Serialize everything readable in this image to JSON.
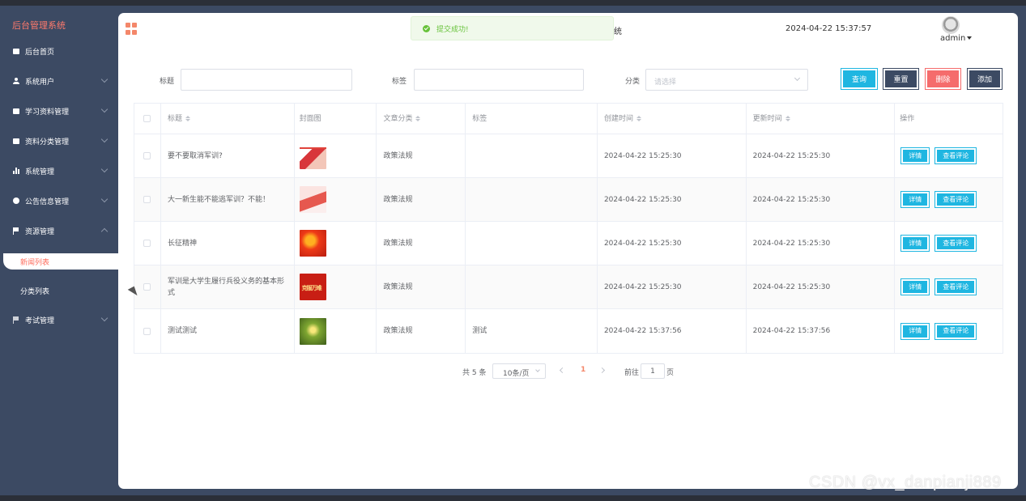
{
  "sidebar": {
    "brand": "后台管理系统",
    "items": [
      {
        "label": "后台首页",
        "icon": "monitor-icon"
      },
      {
        "label": "系统用户",
        "icon": "user-icon"
      },
      {
        "label": "学习资料管理",
        "icon": "doc-icon"
      },
      {
        "label": "资料分类管理",
        "icon": "doc-icon"
      },
      {
        "label": "系统管理",
        "icon": "bar-chart-icon"
      },
      {
        "label": "公告信息管理",
        "icon": "info-icon"
      },
      {
        "label": "资源管理",
        "icon": "flag-icon"
      },
      {
        "label": "考试管理",
        "icon": "flag-icon"
      }
    ],
    "subitems": [
      {
        "label": "新闻列表",
        "active": true
      },
      {
        "label": "分类列表",
        "active": false
      }
    ]
  },
  "header": {
    "toast": "提交成功!",
    "title_fragment": "统",
    "datetime": "2024-04-22 15:37:57",
    "user": "admin"
  },
  "search": {
    "title_label": "标题",
    "tag_label": "标签",
    "category_label": "分类",
    "category_placeholder": "请选择",
    "query_button": "查询",
    "reset_button": "重置",
    "delete_button": "删除",
    "add_button": "添加"
  },
  "table": {
    "columns": [
      "标题",
      "封面图",
      "文章分类",
      "标签",
      "创建时间",
      "更新时间",
      "操作"
    ],
    "detail_button": "详情",
    "comment_button": "查看评论",
    "rows": [
      {
        "title": "要不要取消军训?",
        "category": "政策法规",
        "tag": "",
        "created": "2024-04-22 15:25:30",
        "updated": "2024-04-22 15:25:30"
      },
      {
        "title": "大一新生能不能逃军训？不能！",
        "category": "政策法规",
        "tag": "",
        "created": "2024-04-22 15:25:30",
        "updated": "2024-04-22 15:25:30"
      },
      {
        "title": "长征精神",
        "category": "政策法规",
        "tag": "",
        "created": "2024-04-22 15:25:30",
        "updated": "2024-04-22 15:25:30"
      },
      {
        "title": "军训是大学生履行兵役义务的基本形式",
        "category": "政策法规",
        "tag": "",
        "created": "2024-04-22 15:25:30",
        "updated": "2024-04-22 15:25:30"
      },
      {
        "title": "测试测试",
        "category": "政策法规",
        "tag": "测试",
        "created": "2024-04-22 15:37:56",
        "updated": "2024-04-22 15:37:56"
      }
    ]
  },
  "pagination": {
    "total": "共 5 条",
    "page_size": "10条/页",
    "current": "1",
    "goto_label": "前往",
    "goto_value": "1",
    "page_suffix": "页"
  },
  "watermark": "CSDN @vx_danpianji889",
  "colors": {
    "sidebar_bg": "#3c4a63",
    "accent": "#f4876a",
    "primary_button": "#1fb6e1",
    "danger_button": "#f56c6c",
    "success": "#67c23a"
  }
}
